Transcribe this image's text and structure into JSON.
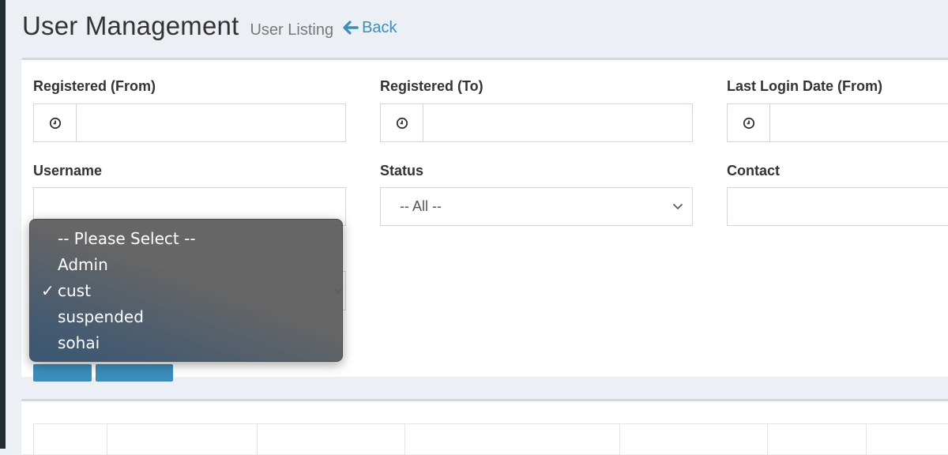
{
  "header": {
    "title": "User Management",
    "subtitle": "User Listing",
    "back_label": "Back"
  },
  "filters": {
    "registered_from": {
      "label": "Registered (From)",
      "icon": "clock-icon",
      "value": ""
    },
    "registered_to": {
      "label": "Registered (To)",
      "icon": "clock-icon",
      "value": ""
    },
    "last_login_from": {
      "label": "Last Login Date (From)",
      "icon": "clock-icon",
      "value": ""
    },
    "username": {
      "label": "Username",
      "value": ""
    },
    "status": {
      "label": "Status",
      "selected": "-- All --"
    },
    "contact": {
      "label": "Contact",
      "value": ""
    }
  },
  "dropdown": {
    "options": [
      "-- Please Select --",
      "Admin",
      "cust",
      "suspended",
      "sohai"
    ],
    "selected": "cust",
    "check_mark": "✓"
  },
  "colors": {
    "accent": "#3c8dbc",
    "background": "#ecf0f5",
    "sidebar": "#222d32"
  }
}
